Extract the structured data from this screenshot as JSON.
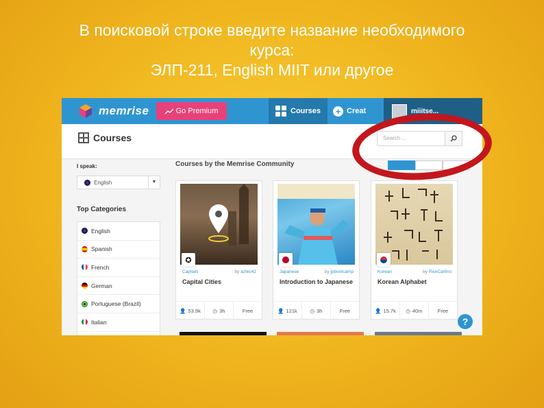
{
  "slide": {
    "title_line1": "В поисковой строке введите название необходимого",
    "title_line2": "курса:",
    "title_line3": "ЭЛП-211, English MIIT или другое"
  },
  "topnav": {
    "logo": "memrise",
    "go_premium": "Go Premium",
    "courses": "Courses",
    "create": "Creat",
    "user": "miiitse..."
  },
  "header": {
    "title": "Courses",
    "search_placeholder": "Search ..."
  },
  "sidebar": {
    "i_speak_label": "I speak:",
    "selected_language": "English",
    "top_categories_label": "Top Categories",
    "categories": [
      {
        "label": "English",
        "flag": "uk"
      },
      {
        "label": "Spanish",
        "flag": "es"
      },
      {
        "label": "French",
        "flag": "fr"
      },
      {
        "label": "German",
        "flag": "de"
      },
      {
        "label": "Portuguese (Brazil)",
        "flag": "br"
      },
      {
        "label": "Italian",
        "flag": "it"
      }
    ]
  },
  "main": {
    "section_title": "Courses by the Memrise Community",
    "sort_tabs": [
      "",
      "",
      ""
    ],
    "cards": [
      {
        "category": "Capitals",
        "by": "by",
        "author": "aztec42",
        "title": "Capital Cities",
        "learners": "53.9k",
        "time": "3h",
        "price": "Free"
      },
      {
        "category": "Japanese",
        "by": "by",
        "author": "jpbootcamp",
        "title": "Introduction to Japanese",
        "learners": "121k",
        "time": "3h",
        "price": "Free"
      },
      {
        "category": "Korean",
        "by": "by",
        "author": "RickCarlino",
        "title": "Korean Alphabet",
        "learners": "15.7k",
        "time": "40m",
        "price": "Free"
      }
    ],
    "help": "?"
  },
  "colors": {
    "brand_blue": "#2f95d1",
    "premium_pink": "#e8417a",
    "highlight_red": "#c3161c"
  }
}
